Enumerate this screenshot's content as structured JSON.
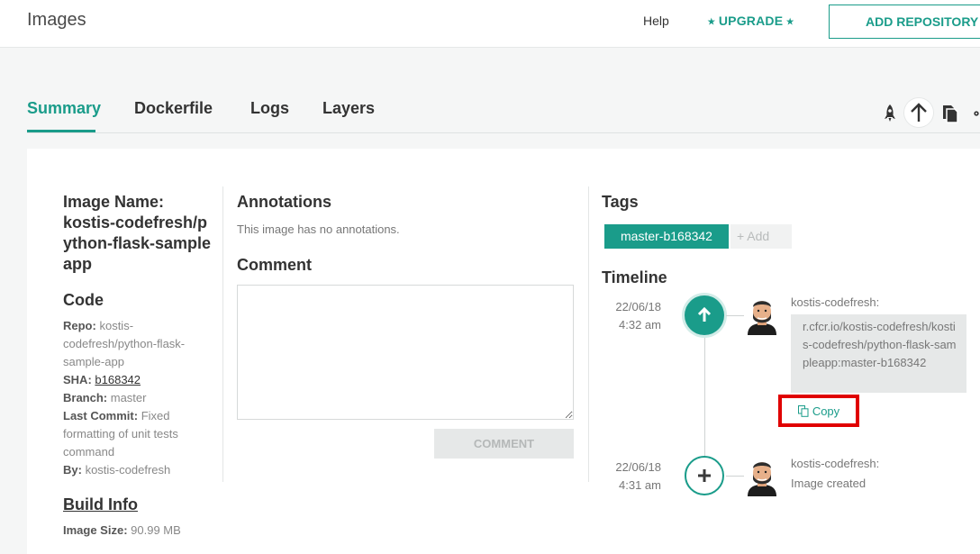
{
  "header": {
    "title": "Images",
    "help_label": "Help",
    "upgrade_label": "⭑ UPGRADE ⭑",
    "add_repository_label": "ADD REPOSITORY"
  },
  "tabs": [
    {
      "label": "Summary",
      "active": true
    },
    {
      "label": "Dockerfile",
      "active": false
    },
    {
      "label": "Logs",
      "active": false
    },
    {
      "label": "Layers",
      "active": false
    }
  ],
  "toolbar": {
    "icons": [
      "rocket-icon",
      "arrow-up-icon",
      "copy-icon",
      "settings-icon"
    ]
  },
  "summary": {
    "image_name_label": "Image Name:",
    "image_name_value": "kostis-codefresh/python-flask-sampleapp",
    "code": {
      "heading": "Code",
      "repo_label": "Repo:",
      "repo_value": "kostis-codefresh/python-flask-sample-app",
      "sha_label": "SHA:",
      "sha_value": "b168342",
      "branch_label": "Branch:",
      "branch_value": "master",
      "last_commit_label": "Last Commit:",
      "last_commit_value": "Fixed formatting of unit tests command",
      "by_label": "By:",
      "by_value": "kostis-codefresh"
    },
    "build_info": {
      "heading": "Build Info",
      "image_size_label": "Image Size:",
      "image_size_value": "90.99 MB"
    }
  },
  "annotations": {
    "heading": "Annotations",
    "empty_text": "This image has no annotations."
  },
  "comment": {
    "heading": "Comment",
    "placeholder": "",
    "button_label": "COMMENT"
  },
  "tags": {
    "heading": "Tags",
    "items": [
      "master-b168342"
    ],
    "add_label": "+ Add"
  },
  "timeline": {
    "heading": "Timeline",
    "events": [
      {
        "date": "22/06/18",
        "time": "4:32 am",
        "icon": "arrow-up-icon",
        "user": "kostis-codefresh:",
        "image_path": "r.cfcr.io/kostis-codefresh/kostis-codefresh/python-flask-sampleapp:master-b168342",
        "copy_label": "Copy"
      },
      {
        "date": "22/06/18",
        "time": "4:31 am",
        "icon": "plus-icon",
        "user": "kostis-codefresh:",
        "event_text": "Image created"
      }
    ]
  },
  "colors": {
    "accent": "#1a9c8a",
    "highlight_border": "#e00000"
  }
}
